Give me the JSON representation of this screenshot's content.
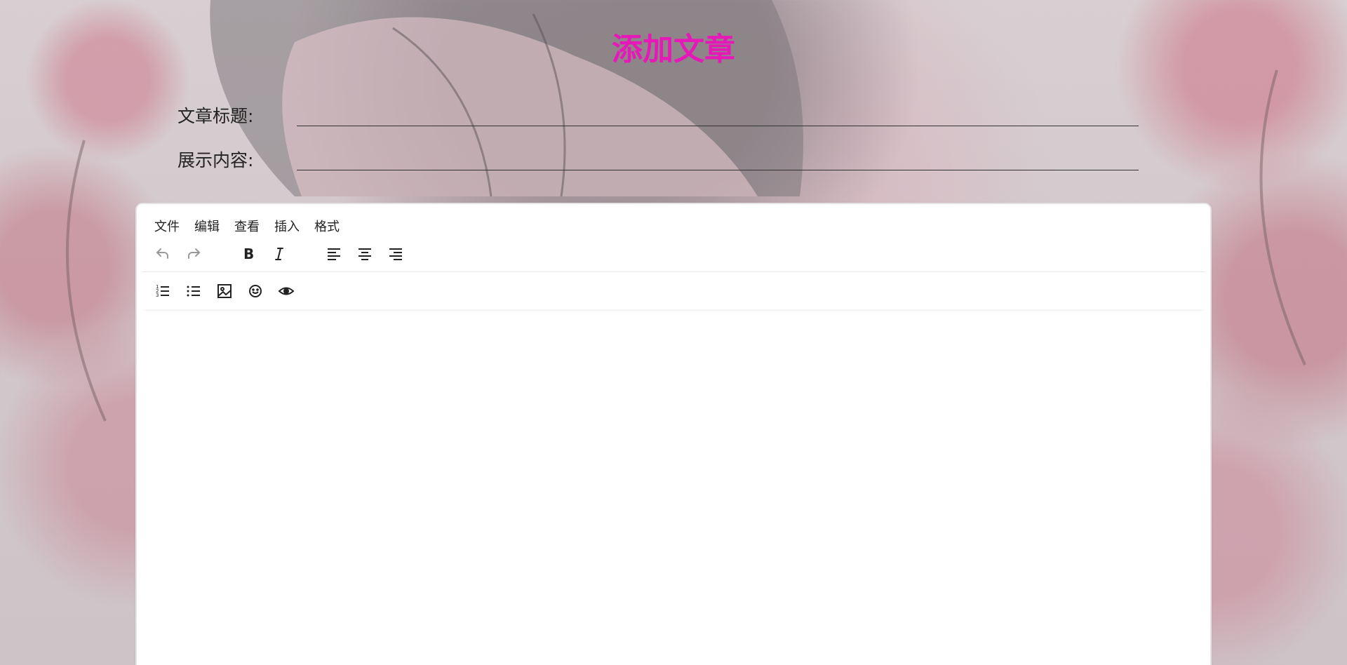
{
  "page": {
    "title": "添加文章"
  },
  "form": {
    "title_label": "文章标题:",
    "title_value": "",
    "summary_label": "展示内容:",
    "summary_value": ""
  },
  "editor": {
    "menu": [
      "文件",
      "编辑",
      "查看",
      "插入",
      "格式"
    ],
    "toolbar_row1": [
      "undo-icon",
      "redo-icon",
      "bold-icon",
      "italic-icon",
      "align-left-icon",
      "align-center-icon",
      "align-right-icon"
    ],
    "toolbar_row2": [
      "numbered-list-icon",
      "bullet-list-icon",
      "image-icon",
      "emoji-icon",
      "preview-icon"
    ],
    "content": ""
  },
  "colors": {
    "title": "#e619b8",
    "text": "#222222"
  }
}
